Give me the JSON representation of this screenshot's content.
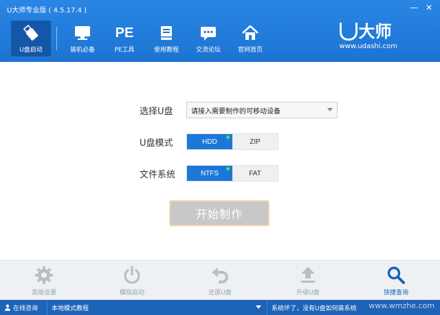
{
  "window": {
    "title": "U大师专业版 ( 4.5.17.4 )",
    "minimize": "—",
    "close": "✕"
  },
  "nav": [
    {
      "label": "U盘启动",
      "icon": "usb-drive-icon",
      "active": true
    },
    {
      "label": "装机必备",
      "icon": "monitor-icon"
    },
    {
      "label": "PE工具",
      "icon": "pe-text-icon",
      "icon_text": "PE"
    },
    {
      "label": "使用教程",
      "icon": "book-icon"
    },
    {
      "label": "交流论坛",
      "icon": "chat-bubble-icon"
    },
    {
      "label": "官网首页",
      "icon": "home-icon"
    }
  ],
  "brand": {
    "name": "大师",
    "url": "www.udashi.com"
  },
  "form": {
    "usb_label": "选择U盘",
    "usb_select_value": "请接入需要制作的可移动设备",
    "mode_label": "U盘模式",
    "mode_options": [
      "HDD",
      "ZIP"
    ],
    "mode_selected": "HDD",
    "fs_label": "文件系统",
    "fs_options": [
      "NTFS",
      "FAT"
    ],
    "fs_selected": "NTFS",
    "start_button": "开始制作"
  },
  "tools": [
    {
      "label": "高级设置",
      "icon": "gear-icon"
    },
    {
      "label": "模拟启动",
      "icon": "power-icon"
    },
    {
      "label": "还原U盘",
      "icon": "undo-arrow-icon"
    },
    {
      "label": "升级U盘",
      "icon": "upgrade-arrow-icon"
    },
    {
      "label": "快捷查询",
      "icon": "magnifier-icon",
      "active": true
    }
  ],
  "status": {
    "online": "在线咨询",
    "tutorial": "本地模式教程",
    "notice": "系统坏了，没有U盘如何装系统",
    "watermark": "www.wmzhe.com"
  },
  "colors": {
    "header": "#1c73d2",
    "accent": "#1c78d8",
    "status_bar": "#1d63b8",
    "indicator": "#4ee04a"
  }
}
